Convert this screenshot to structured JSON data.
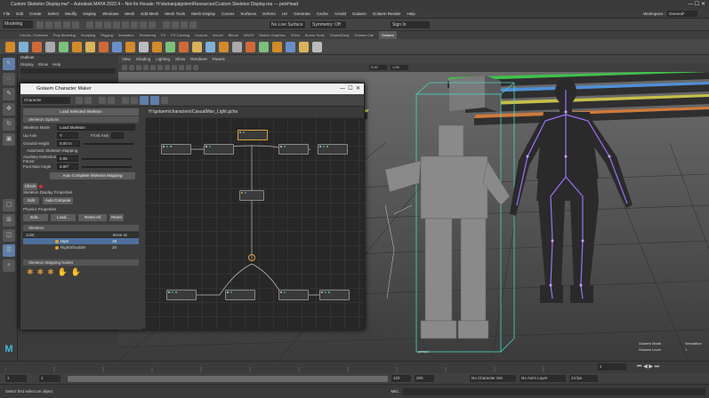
{
  "window": {
    "title": "Custom Skeleton Display.ma* – Autodesk MAYA 2022.4 – Not for Resale: H:\\dumanjalgolem\\Resources\\Custom Skeleton Display.ma --- pelvHead"
  },
  "menus": [
    "File",
    "Edit",
    "Create",
    "Select",
    "Modify",
    "Display",
    "Windows",
    "Mesh",
    "Edit Mesh",
    "Mesh Tools",
    "Mesh Display",
    "Curves",
    "Surfaces",
    "Deform",
    "UV",
    "Generate",
    "Cache",
    "Arnold",
    "Golaem",
    "Golaem Render",
    "Help"
  ],
  "workspace": {
    "label": "Workspace :",
    "value": "General*"
  },
  "statusline": {
    "mode": "Modeling",
    "live": "No Live Surface",
    "symmetry": "Symmetry: Off",
    "sign_in": "Sign In"
  },
  "shelf_tabs": [
    "Curves / Surfaces",
    "Poly Modeling",
    "Sculpting",
    "Rigging",
    "Animation",
    "Rendering",
    "FX",
    "FX Caching",
    "Custom",
    "Arnold",
    "Bifrost",
    "MASH",
    "Motion Graphics",
    "XGen",
    "Bonus Tools",
    "GnomeDerg",
    "Golaem Lite",
    "Golaem"
  ],
  "outliner": {
    "title": "Outliner",
    "menu": [
      "Display",
      "Show",
      "Help"
    ]
  },
  "viewport": {
    "menu": [
      "View",
      "Shading",
      "Lighting",
      "Show",
      "Renderer",
      "Panels"
    ],
    "camera_label": "persp1",
    "field1": "0.00",
    "field2": "1.00",
    "hud_mode_label": "Golaem Mode",
    "hud_mode_value": "Simulation",
    "hud_level_label": "Golaem Level",
    "hud_level_value": "1"
  },
  "gcm": {
    "title": "Golaem Character Maker",
    "toolbar_select": "Character",
    "path": "H:\\golaem\\characters\\CasualMan_Light.gcha",
    "load_selected": "Load Selected Skeleton",
    "skeleton_options": "Skeleton Options",
    "skeleton_mode_label": "Skeleton Mode",
    "skeleton_mode_value": "Load Skeleton",
    "up_axis_label": "Up Axis",
    "up_axis_value": "Y",
    "front_axis_label": "Front Axis",
    "ground_height_label": "Ground Height",
    "ground_height_value": "0.00 m",
    "auto_mapping": "Automatic Skeleton Mapping",
    "aux_factor_label": "Auxiliary Detection Factor",
    "aux_factor_value": "0.05",
    "foot_angle_label": "Foot Max Angle",
    "foot_angle_value": "3.00°",
    "auto_complete": "Auto Complete Skeleton Mapping",
    "check": "Check",
    "display_props": "Skeleton Display Properties",
    "edit": "Edit",
    "auto_compute": "Auto Compute",
    "physics": "Physics Properties",
    "edit2": "Edit...",
    "load": "Load...",
    "reset_all": "Reset All",
    "reset": "Reset",
    "skeleton": "Skeleton",
    "col_joint": "Joint",
    "col_bone": "Bone Id",
    "rows": [
      {
        "name": "Hips",
        "id": "19"
      },
      {
        "name": "RightShoulder",
        "id": "20"
      }
    ],
    "mapping_nodes": "Skeleton Mapping Nodes"
  },
  "timeline": {
    "start": "1",
    "end": "120",
    "range_start": "1",
    "range_end": "120",
    "range_max": "200",
    "current": "1",
    "fps": "24 fps",
    "anim_layer": "No Anim Layer",
    "char_set": "No Character Set"
  },
  "helpline": {
    "mel": "MEL",
    "hint": "Select first select an object"
  }
}
